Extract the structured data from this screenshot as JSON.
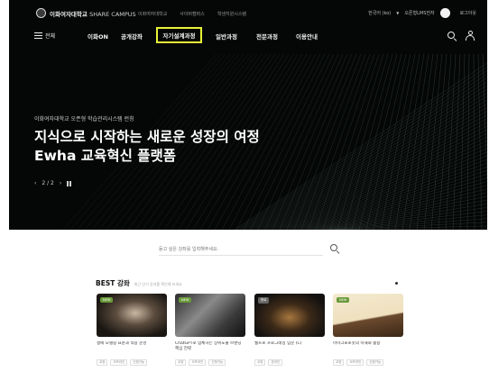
{
  "brand": {
    "name_ko": "이화여자대학교",
    "name_en": "SHARE CAMPUS"
  },
  "utility_links": [
    "이화여자대학교",
    "사이버캠퍼스",
    "학생지원시스템"
  ],
  "language": "한국어 (ko)",
  "lms_label": "오픈형LMS전자",
  "login_label": "로그아웃",
  "menu_label": "전체",
  "nav": {
    "items": [
      "이화ON",
      "공개강좌",
      "자기설계과정",
      "일반과정",
      "전문과정",
      "이용안내"
    ],
    "highlight_index": 2
  },
  "hero": {
    "subtitle": "이화여자대학교 오픈형 학습관리시스템 런칭",
    "title_line1": "지식으로 시작하는 새로운 성장의 여정",
    "title_line2": "Ewha 교육혁신 플랫폼",
    "pager": "2 / 2",
    "prev": "‹",
    "next": "›"
  },
  "search": {
    "placeholder": "듣고 싶은 강좌를 입력해주세요."
  },
  "best": {
    "title": "BEST 강좌",
    "description": "최근 인기 강좌를 확인해 보세요"
  },
  "cards": [
    {
      "badge": "NEW",
      "title": "생애 모델링 표준과 적용 운영",
      "meta": [
        "교양",
        "오프라인",
        "신청가능"
      ],
      "color": "#6a9a3a"
    },
    {
      "badge": "NEW",
      "title": "ChatGPT로 업체하는 상위노출 브랜딩 핵심 전략",
      "meta": [
        "교양",
        "오프라인",
        "신청가능"
      ],
      "color": "#6a9a3a"
    },
    {
      "badge": "종료",
      "title": "웹프로 프로그래밍 입문 (C)",
      "meta": [
        "교양",
        "온라인"
      ],
      "color": "#666666"
    },
    {
      "badge": "NEW",
      "title": "마이크로로봇의 이해와 활용",
      "meta": [
        "교양",
        "오프라인",
        "신청가능"
      ],
      "color": "#6a9a3a"
    }
  ],
  "colors": {
    "hero_bg": "#050707",
    "nav_highlight": "#e8f236"
  }
}
